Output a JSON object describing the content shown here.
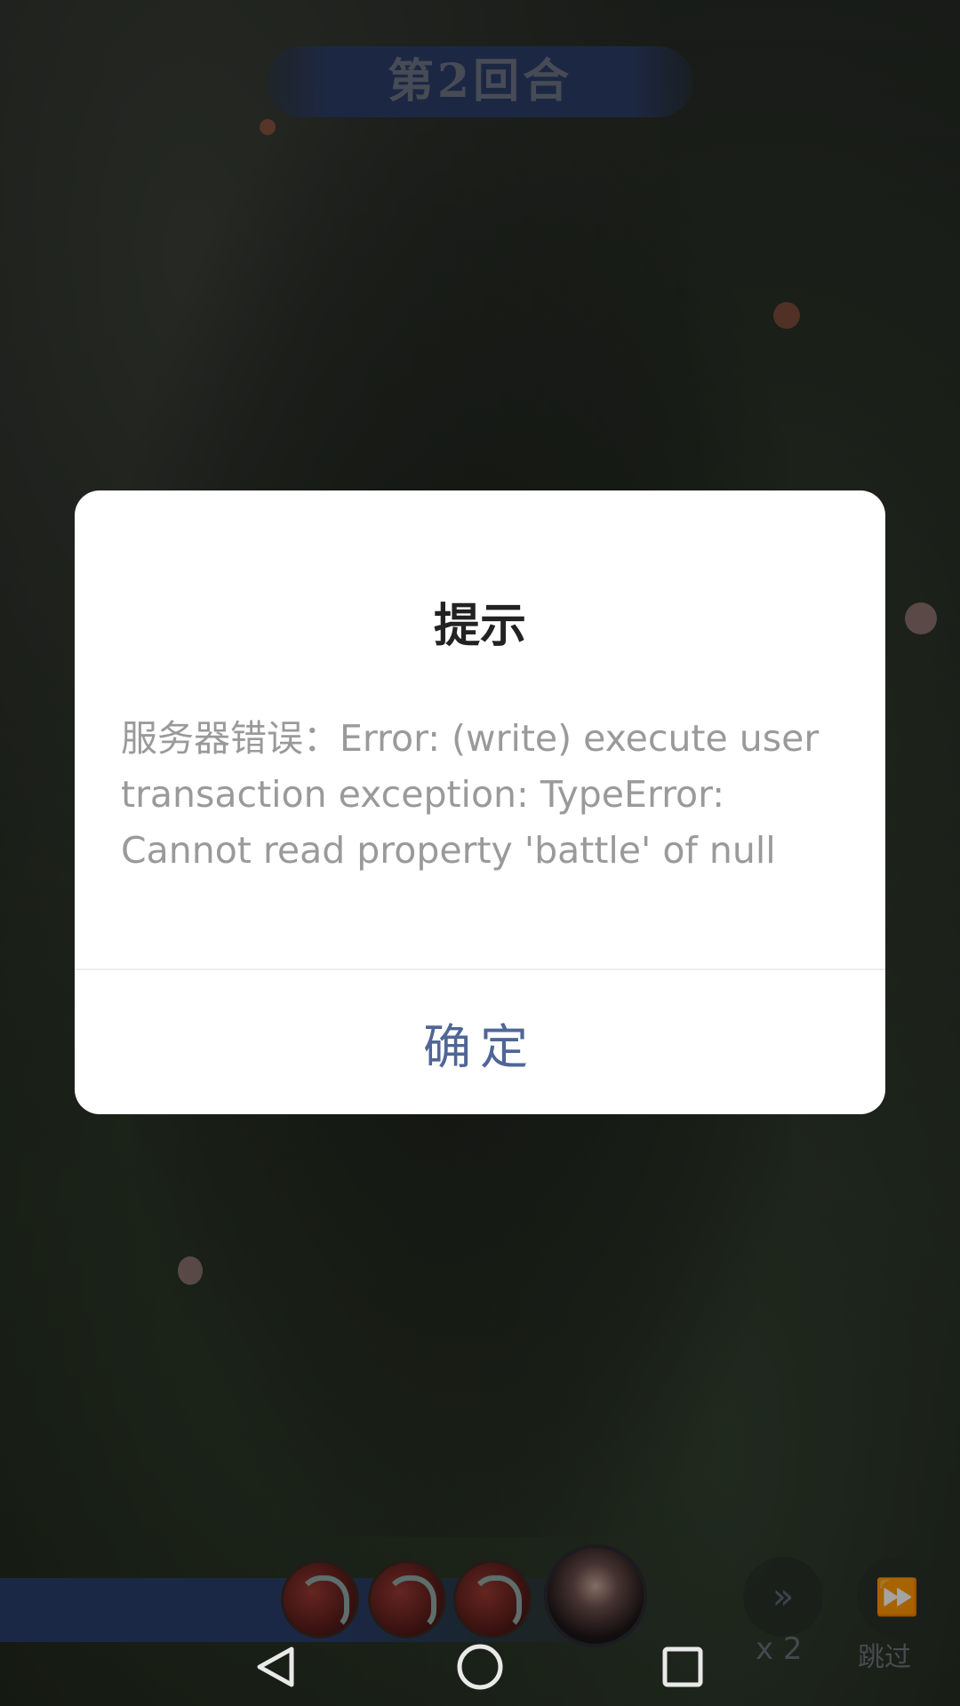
{
  "round": {
    "label": "第2回合"
  },
  "dialog": {
    "title": "提示",
    "message": "服务器错误：Error: (write) execute user transaction exception: TypeError: Cannot read property 'battle' of null",
    "confirm_label": "确定"
  },
  "battle_bar": {
    "units": [
      "dragon-unit-icon",
      "dragon-unit-icon",
      "dragon-unit-icon"
    ],
    "hero": "hero-portrait",
    "speed_label": "x 2",
    "skip_label": "跳过"
  },
  "nav": {
    "icons": [
      "back-icon",
      "home-icon",
      "recents-icon"
    ]
  },
  "colors": {
    "confirm": "#4f6696",
    "banner": "#2c3e68",
    "message": "#9a9a9a"
  }
}
